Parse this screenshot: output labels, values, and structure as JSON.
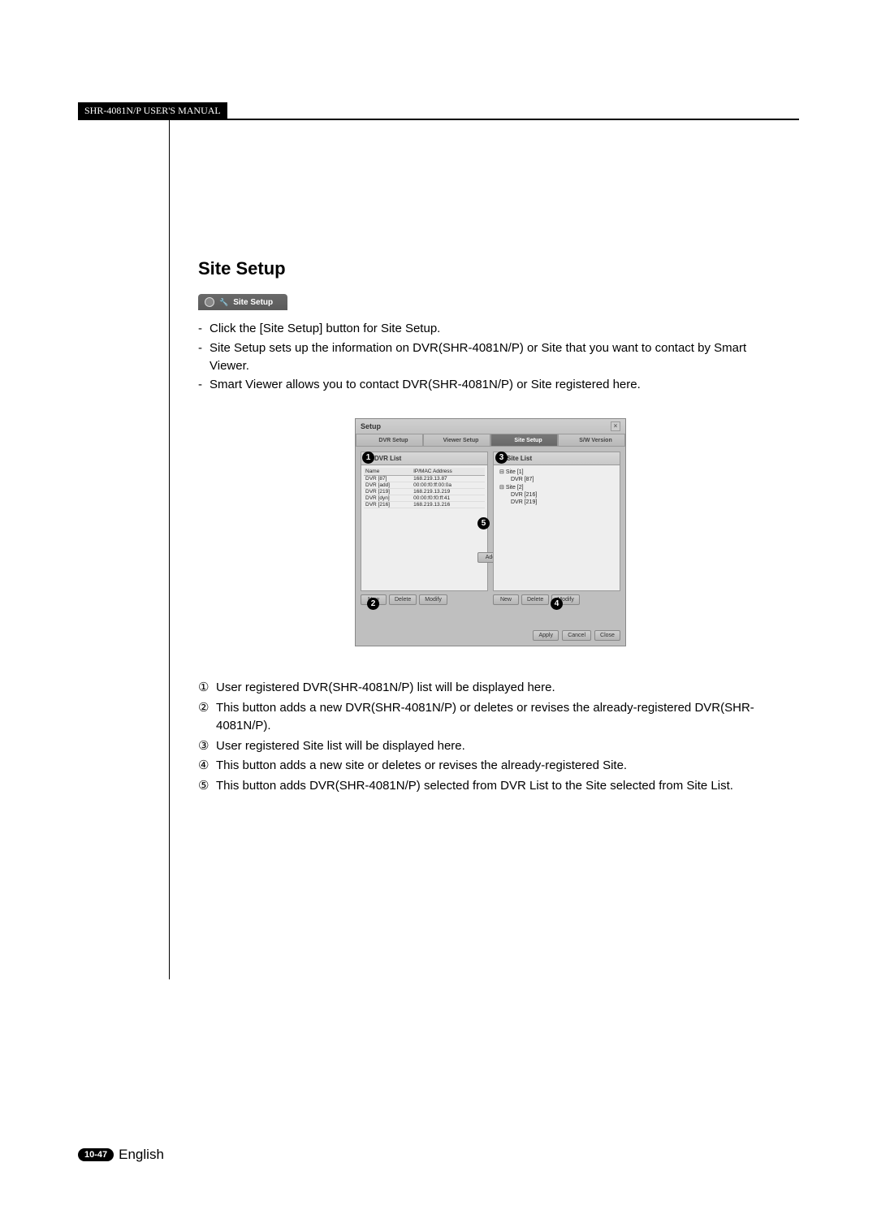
{
  "header": {
    "label": "SHR-4081N/P USER'S MANUAL"
  },
  "section": {
    "title": "Site Setup",
    "tab_label": "Site Setup",
    "bullets": [
      "Click the [Site Setup] button for Site Setup.",
      "Site Setup sets up the information on DVR(SHR-4081N/P) or Site that you want to contact by Smart Viewer.",
      "Smart Viewer allows you to contact DVR(SHR-4081N/P) or Site registered here."
    ]
  },
  "dialog": {
    "title": "Setup",
    "tabs": [
      "DVR Setup",
      "Viewer Setup",
      "Site Setup",
      "S/W Version"
    ],
    "active_tab": 2,
    "dvr_panel": {
      "title": "DVR List",
      "columns": [
        "Name",
        "IP/MAC Address"
      ],
      "rows": [
        [
          "DVR [87]",
          "168.219.13.87"
        ],
        [
          "DVR [add]",
          "00:00:f0:ff:00:0a"
        ],
        [
          "DVR [219]",
          "168.219.13.219"
        ],
        [
          "DVR [dyn]",
          "00:00:f0:f0:ff:41"
        ],
        [
          "DVR [216]",
          "168.219.13.216"
        ]
      ],
      "buttons": [
        "New",
        "Delete",
        "Modify"
      ]
    },
    "add_button": "Add",
    "site_panel": {
      "title": "Site List",
      "tree": [
        {
          "label": "Site [1]",
          "children": [
            "DVR [87]"
          ]
        },
        {
          "label": "Site [2]",
          "children": [
            "DVR [216]",
            "DVR [219]"
          ]
        }
      ],
      "buttons": [
        "New",
        "Delete",
        "Modify"
      ]
    },
    "footer_buttons": [
      "Apply",
      "Cancel",
      "Close"
    ]
  },
  "callouts": {
    "1": "1",
    "2": "2",
    "3": "3",
    "4": "4",
    "5": "5"
  },
  "legend": [
    {
      "n": "①",
      "text": "User registered DVR(SHR-4081N/P) list will be displayed here."
    },
    {
      "n": "②",
      "text": "This button adds a new DVR(SHR-4081N/P) or deletes or revises the already-registered DVR(SHR-4081N/P)."
    },
    {
      "n": "③",
      "text": "User registered Site list will be displayed here."
    },
    {
      "n": "④",
      "text": "This button adds a new site or deletes or revises the already-registered Site."
    },
    {
      "n": "⑤",
      "text": "This button adds DVR(SHR-4081N/P) selected from DVR List to the Site selected from Site List."
    }
  ],
  "footer": {
    "page": "10-47",
    "language": "English"
  }
}
